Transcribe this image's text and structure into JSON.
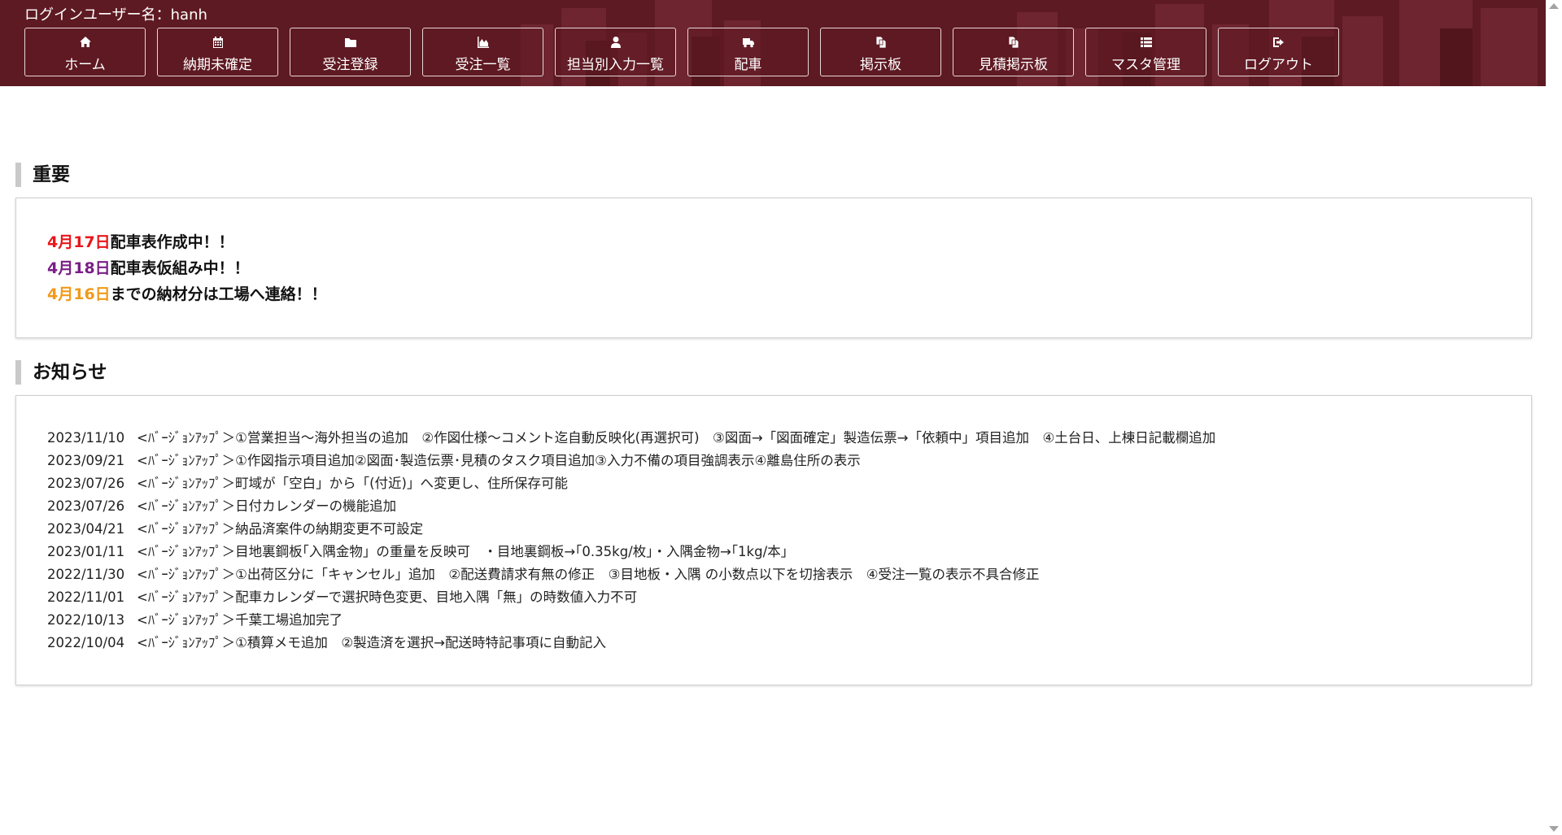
{
  "header": {
    "login_label": "ログインユーザー名：hanh",
    "nav": [
      {
        "label": "ホーム",
        "icon": "home-icon"
      },
      {
        "label": "納期未確定",
        "icon": "calendar-icon"
      },
      {
        "label": "受注登録",
        "icon": "folder-icon"
      },
      {
        "label": "受注一覧",
        "icon": "area-chart-icon"
      },
      {
        "label": "担当別入力一覧",
        "icon": "user-icon"
      },
      {
        "label": "配車",
        "icon": "truck-icon"
      },
      {
        "label": "掲示板",
        "icon": "copy-icon"
      },
      {
        "label": "見積掲示板",
        "icon": "copy-icon"
      },
      {
        "label": "マスタ管理",
        "icon": "list-icon"
      },
      {
        "label": "ログアウト",
        "icon": "sign-out-icon"
      }
    ]
  },
  "important": {
    "title": "重要",
    "lines": [
      {
        "date": "4月17日",
        "text": "配車表作成中！！",
        "color": "#e8161b"
      },
      {
        "date": "4月18日",
        "text": "配車表仮組み中！！",
        "color": "#7a1f86"
      },
      {
        "date": "4月16日",
        "text": "までの納材分は工場へ連絡！！",
        "color": "#f19a1a"
      }
    ]
  },
  "news": {
    "title": "お知らせ",
    "items": [
      {
        "date": "2023/11/10",
        "text": "<ﾊﾞｰｼﾞｮﾝｱｯﾌﾟ＞①営業担当～海外担当の追加　②作図仕様～コメント迄自動反映化(再選択可)　③図面→「図面確定」製造伝票→「依頼中」項目追加　④土台日、上棟日記載欄追加"
      },
      {
        "date": "2023/09/21",
        "text": "<ﾊﾞｰｼﾞｮﾝｱｯﾌﾟ＞①作図指示項目追加②図面･製造伝票･見積のタスク項目追加③入力不備の項目強調表示④離島住所の表示"
      },
      {
        "date": "2023/07/26",
        "text": "<ﾊﾞｰｼﾞｮﾝｱｯﾌﾟ＞町域が「空白」から「(付近)」へ変更し、住所保存可能"
      },
      {
        "date": "2023/07/26",
        "text": "<ﾊﾞｰｼﾞｮﾝｱｯﾌﾟ＞日付カレンダーの機能追加"
      },
      {
        "date": "2023/04/21",
        "text": "<ﾊﾞｰｼﾞｮﾝｱｯﾌﾟ＞納品済案件の納期変更不可設定"
      },
      {
        "date": "2023/01/11",
        "text": "<ﾊﾞｰｼﾞｮﾝｱｯﾌﾟ＞目地裏鋼板｢入隅金物」の重量を反映可　・目地裏鋼板→｢0.35kg/枚｣・入隅金物→｢1kg/本｣"
      },
      {
        "date": "2022/11/30",
        "text": "<ﾊﾞｰｼﾞｮﾝｱｯﾌﾟ＞①出荷区分に「キャンセル」追加　②配送費請求有無の修正　③目地板・入隅 の小数点以下を切捨表示　④受注一覧の表示不具合修正"
      },
      {
        "date": "2022/11/01",
        "text": "<ﾊﾞｰｼﾞｮﾝｱｯﾌﾟ＞配車カレンダーで選択時色変更、目地入隅「無」の時数値入力不可"
      },
      {
        "date": "2022/10/13",
        "text": "<ﾊﾞｰｼﾞｮﾝｱｯﾌﾟ＞千葉工場追加完了"
      },
      {
        "date": "2022/10/04",
        "text": "<ﾊﾞｰｼﾞｮﾝｱｯﾌﾟ＞①積算メモ追加　②製造済を選択→配送時特記事項に自動記入"
      }
    ]
  }
}
